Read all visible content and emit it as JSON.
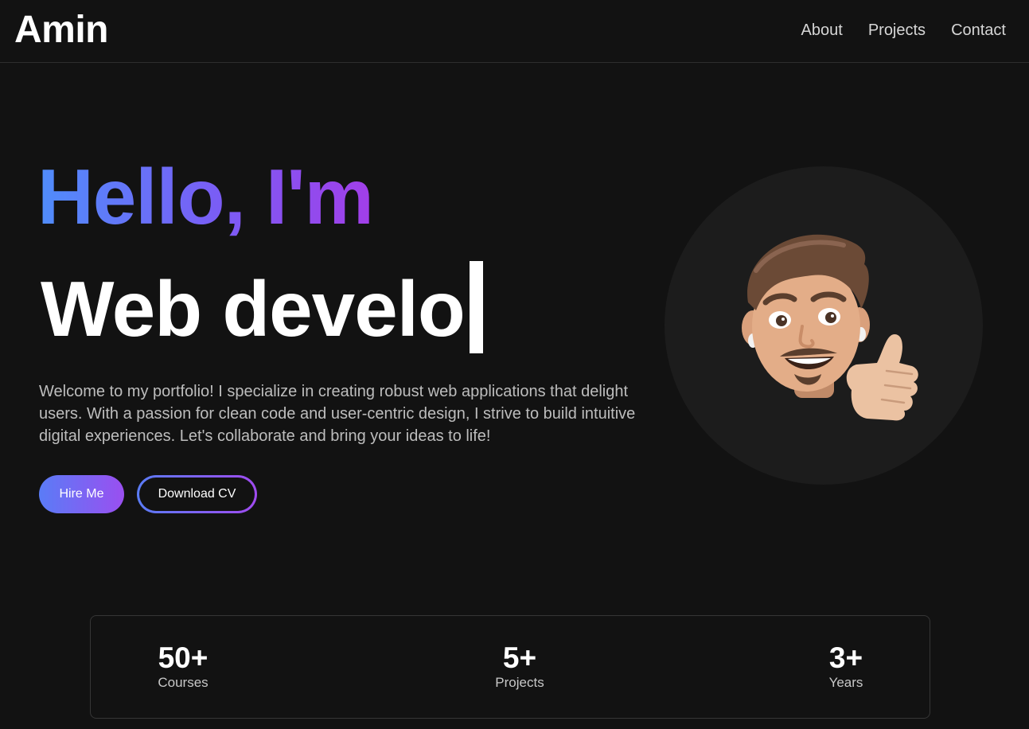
{
  "header": {
    "logo": "Amin",
    "nav": [
      {
        "label": "About"
      },
      {
        "label": "Projects"
      },
      {
        "label": "Contact"
      }
    ]
  },
  "hero": {
    "greeting": "Hello, I'm",
    "role_typed": "Web develo",
    "intro": "Welcome to my portfolio! I specialize in creating robust web applications that delight users. With a passion for clean code and user-centric design, I strive to build intuitive digital experiences. Let's collaborate and bring your ideas to life!",
    "hire_label": "Hire Me",
    "cv_label": "Download CV",
    "avatar_icon": "memoji-thumbs-up-avatar"
  },
  "stats": [
    {
      "value": "50+",
      "label": "Courses"
    },
    {
      "value": "5+",
      "label": "Projects"
    },
    {
      "value": "3+",
      "label": "Years"
    }
  ],
  "colors": {
    "background": "#121212",
    "gradient_start": "#4f8dfb",
    "gradient_end": "#a23ee8",
    "text_muted": "#bdbdbd"
  }
}
